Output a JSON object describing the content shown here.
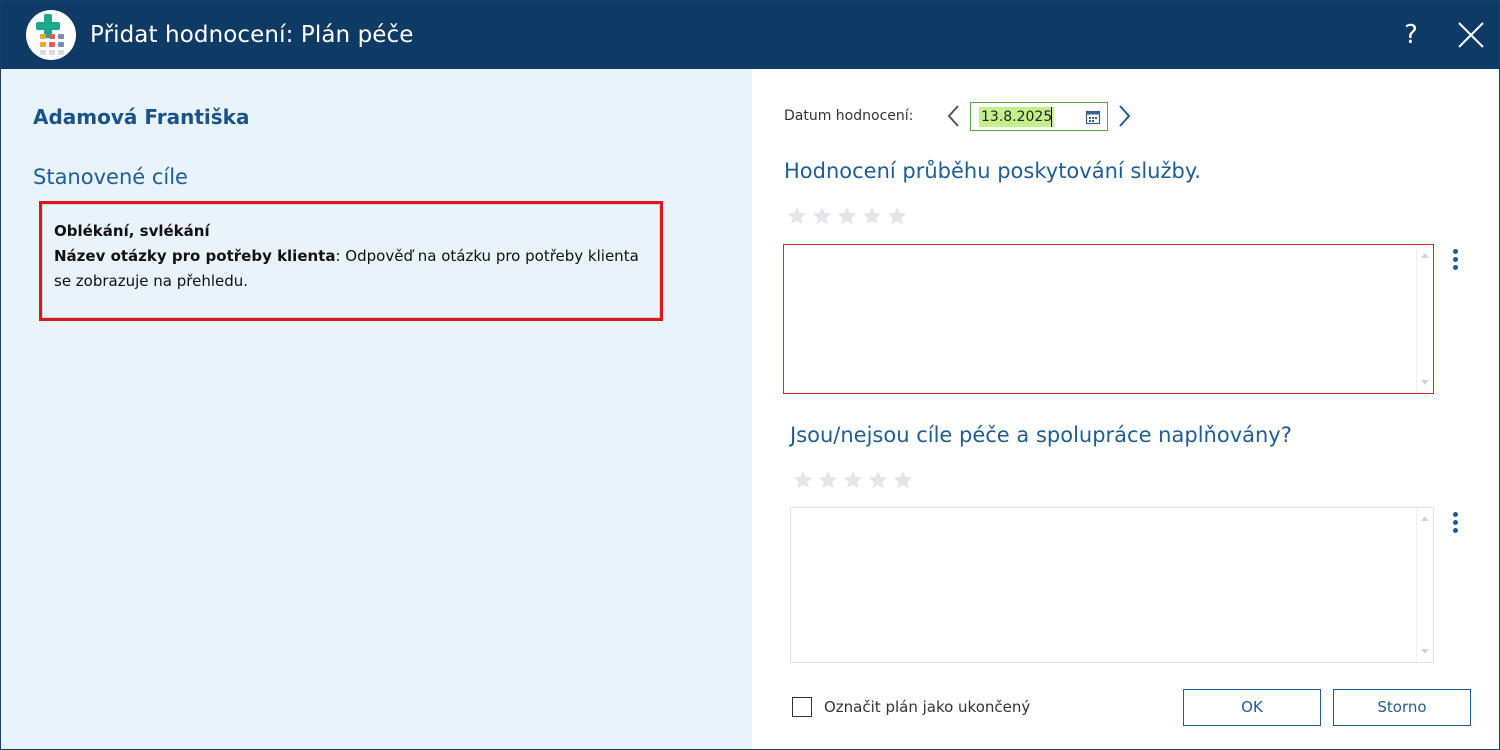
{
  "window": {
    "title": "Přidat hodnocení: Plán péče",
    "help_label": "?"
  },
  "left": {
    "client_name": "Adamová Františka",
    "goals_heading": "Stanovené cíle",
    "goal": {
      "title": "Oblékání, svlékání",
      "question_label": "Název otázky pro potřeby klienta",
      "answer": ": Odpověď na otázku pro potřeby klienta se zobrazuje na přehledu."
    }
  },
  "right": {
    "date_label": "Datum hodnocení:",
    "date_value": "13.8.2025",
    "question1": {
      "heading": "Hodnocení průběhu poskytování služby.",
      "rating": 0,
      "max_rating": 5,
      "text": ""
    },
    "question2": {
      "heading": "Jsou/nejsou cíle péče a spolupráce naplňovány?",
      "rating": 0,
      "max_rating": 5,
      "text": ""
    },
    "checkbox_label": "Označit plán jako ukončený",
    "checkbox_checked": false,
    "ok_label": "OK",
    "cancel_label": "Storno"
  },
  "colors": {
    "titlebar": "#0d3b66",
    "left_panel_bg": "#e9f3fb",
    "heading_blue": "#1e5e94",
    "error_red": "#e0141b",
    "date_highlight": "#c4f08c",
    "date_border": "#59a83b",
    "star_empty": "#e2e6ea"
  }
}
